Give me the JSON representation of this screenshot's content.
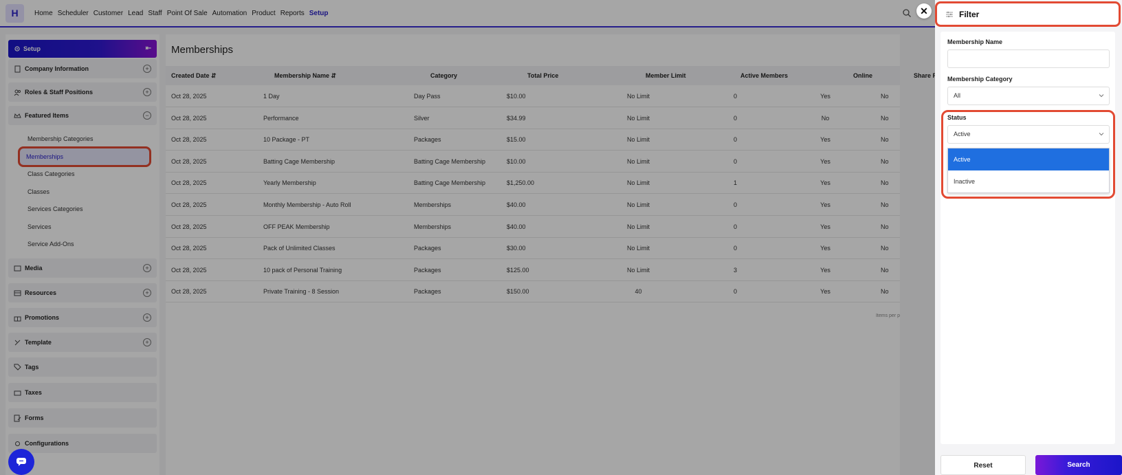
{
  "app": {
    "logo_letter": "H"
  },
  "nav": [
    "Home",
    "Scheduler",
    "Customer",
    "Lead",
    "Staff",
    "Point Of Sale",
    "Automation",
    "Product",
    "Reports",
    "Setup"
  ],
  "nav_active": "Setup",
  "sidebar": {
    "header": "Setup",
    "sections": [
      {
        "label": "Company Information",
        "icon": "building-icon"
      },
      {
        "label": "Roles & Staff Positions",
        "icon": "users-icon"
      },
      {
        "label": "Featured Items",
        "icon": "crown-icon"
      },
      {
        "label": "Media",
        "icon": "media-icon"
      },
      {
        "label": "Resources",
        "icon": "resources-icon"
      },
      {
        "label": "Promotions",
        "icon": "gift-icon"
      },
      {
        "label": "Template",
        "icon": "template-icon"
      },
      {
        "label": "Tags",
        "icon": "tag-icon"
      },
      {
        "label": "Taxes",
        "icon": "taxes-icon"
      },
      {
        "label": "Forms",
        "icon": "forms-icon"
      },
      {
        "label": "Configurations",
        "icon": "config-icon"
      }
    ],
    "featured_items": [
      "Membership Categories",
      "Memberships",
      "Class Categories",
      "Classes",
      "Services Categories",
      "Services",
      "Service Add-Ons"
    ],
    "active_item": "Memberships"
  },
  "main": {
    "title": "Memberships",
    "columns": [
      "Created Date",
      "Membership Name",
      "Category",
      "Total Price",
      "Member Limit",
      "Active Members",
      "Online",
      "Share P"
    ],
    "rows": [
      [
        "Oct 28, 2025",
        "1 Day",
        "Day Pass",
        "$10.00",
        "No Limit",
        "0",
        "Yes",
        "No"
      ],
      [
        "Oct 28, 2025",
        "Performance",
        "Silver",
        "$34.99",
        "No Limit",
        "0",
        "No",
        "No"
      ],
      [
        "Oct 28, 2025",
        "10 Package - PT",
        "Packages",
        "$15.00",
        "No Limit",
        "0",
        "Yes",
        "No"
      ],
      [
        "Oct 28, 2025",
        "Batting Cage Membership",
        "Batting Cage Membership",
        "$10.00",
        "No Limit",
        "0",
        "Yes",
        "No"
      ],
      [
        "Oct 28, 2025",
        "Yearly Membership",
        "Batting Cage Membership",
        "$1,250.00",
        "No Limit",
        "1",
        "Yes",
        "No"
      ],
      [
        "Oct 28, 2025",
        "Monthly Membership - Auto Roll",
        "Memberships",
        "$40.00",
        "No Limit",
        "0",
        "Yes",
        "No"
      ],
      [
        "Oct 28, 2025",
        "OFF PEAK Membership",
        "Memberships",
        "$40.00",
        "No Limit",
        "0",
        "Yes",
        "No"
      ],
      [
        "Oct 28, 2025",
        "Pack of Unlimited Classes",
        "Packages",
        "$30.00",
        "No Limit",
        "0",
        "Yes",
        "No"
      ],
      [
        "Oct 28, 2025",
        "10 pack of Personal Training",
        "Packages",
        "$125.00",
        "No Limit",
        "3",
        "Yes",
        "No"
      ],
      [
        "Oct 28, 2025",
        "Private Training - 8 Session",
        "Packages",
        "$150.00",
        "40",
        "0",
        "Yes",
        "No"
      ]
    ],
    "pager": "Items per p"
  },
  "filter": {
    "title": "Filter",
    "membership_name_label": "Membership Name",
    "membership_name_value": "",
    "category_label": "Membership Category",
    "category_value": "All",
    "status_label": "Status",
    "status_value": "Active",
    "status_options": [
      "Active",
      "Inactive"
    ],
    "reset_label": "Reset",
    "search_label": "Search",
    "close_glyph": "✕"
  },
  "colors": {
    "accent": "#2b22c8",
    "highlight": "#e24a33",
    "selected_option": "#1f6fe0"
  }
}
